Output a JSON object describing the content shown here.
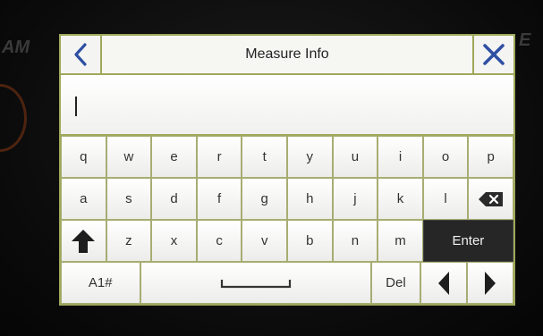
{
  "header": {
    "title": "Measure Info"
  },
  "input": {
    "value": ""
  },
  "keyboard": {
    "rows": [
      [
        "q",
        "w",
        "e",
        "r",
        "t",
        "y",
        "u",
        "i",
        "o",
        "p"
      ],
      [
        "a",
        "s",
        "d",
        "f",
        "g",
        "h",
        "j",
        "k",
        "l"
      ],
      [
        "z",
        "x",
        "c",
        "v",
        "b",
        "n",
        "m"
      ]
    ],
    "enter_label": "Enter",
    "mode_label": "A1#",
    "delete_label": "Del"
  },
  "icons": {
    "back": "chevron-left-icon",
    "close": "close-icon",
    "backspace": "backspace-icon",
    "shift": "shift-arrow-up-icon",
    "space": "space-bar-icon",
    "cursor_left": "cursor-left-icon",
    "cursor_right": "cursor-right-icon"
  },
  "colors": {
    "accent_blue": "#2f4fa3",
    "key_border": "#a7ad72",
    "dark_key": "#262626"
  }
}
